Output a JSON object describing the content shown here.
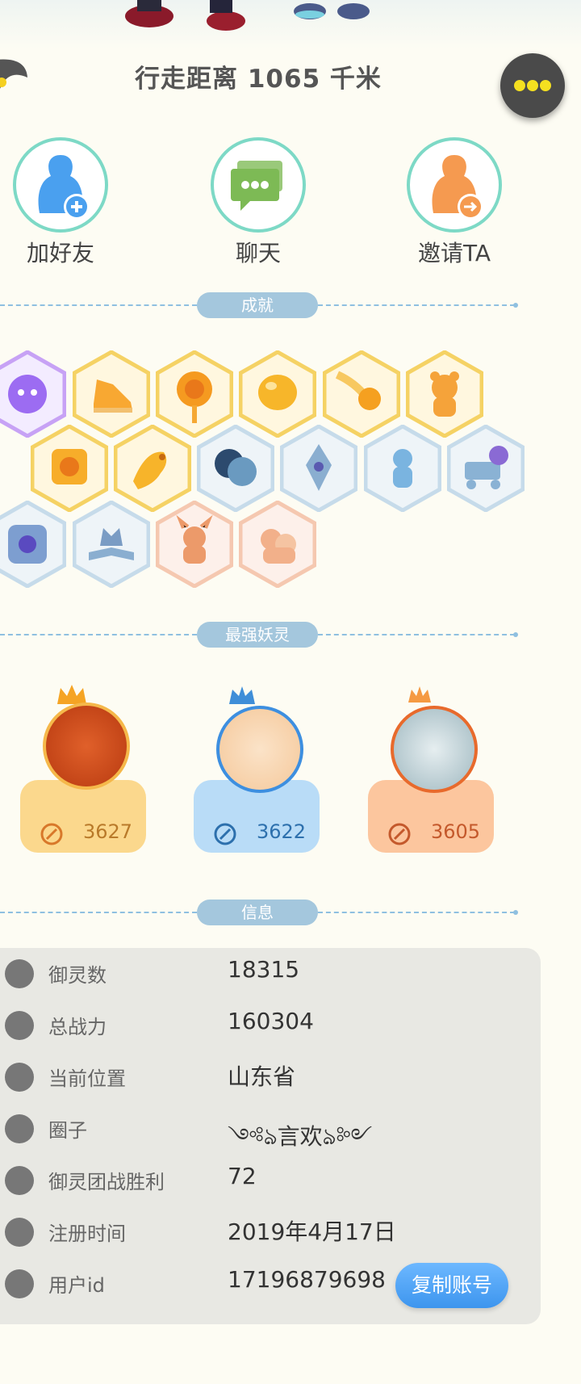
{
  "profile": {
    "distance_text": "行走距离 1065 千米"
  },
  "actions": [
    {
      "label": "加好友",
      "icon": "add-friend-icon"
    },
    {
      "label": "聊天",
      "icon": "chat-icon"
    },
    {
      "label": "邀请TA",
      "icon": "invite-icon"
    }
  ],
  "sections": {
    "achievements": "成就",
    "strongest": "最强妖灵",
    "info": "信息"
  },
  "achievement_icons": [
    "purple-creature-icon",
    "sneaker-icon",
    "orange-sun-icon",
    "golden-egg-icon",
    "meteor-icon",
    "teddy-bear-icon",
    "yinyang-block-icon",
    "golden-dragon-icon",
    "moon-eclipse-icon",
    "blue-crystal-icon",
    "water-spirit-icon",
    "stroller-cat-icon",
    "shield-badge-icon",
    "wolf-book-icon",
    "horned-spirit-icon",
    "twin-cat-icon"
  ],
  "monsters": [
    {
      "score": "3627",
      "crown": "gold-crown-icon",
      "card_color": "#fbd88d",
      "text_color": "#b97a2a"
    },
    {
      "score": "3622",
      "crown": "blue-crown-icon",
      "card_color": "#b9dcf7",
      "text_color": "#2d70ad"
    },
    {
      "score": "3605",
      "crown": "orange-crown-icon",
      "card_color": "#fcc69e",
      "text_color": "#c4592c"
    }
  ],
  "info": [
    {
      "key": "御灵数",
      "value": "18315",
      "icon": "spirit-count-icon"
    },
    {
      "key": "总战力",
      "value": "160304",
      "icon": "sword-icon"
    },
    {
      "key": "当前位置",
      "value": "山东省",
      "icon": "location-pin-icon"
    },
    {
      "key": "圈子",
      "value": "༺ঌ言欢ঌ༻",
      "icon": "circle-group-icon"
    },
    {
      "key": "御灵团战胜利",
      "value": "72",
      "icon": "trophy-figure-icon"
    },
    {
      "key": "注册时间",
      "value": "2019年4月17日",
      "icon": "clock-icon"
    },
    {
      "key": "用户id",
      "value": "17196879698",
      "icon": "id-card-icon"
    }
  ],
  "copy_button_label": "复制账号"
}
